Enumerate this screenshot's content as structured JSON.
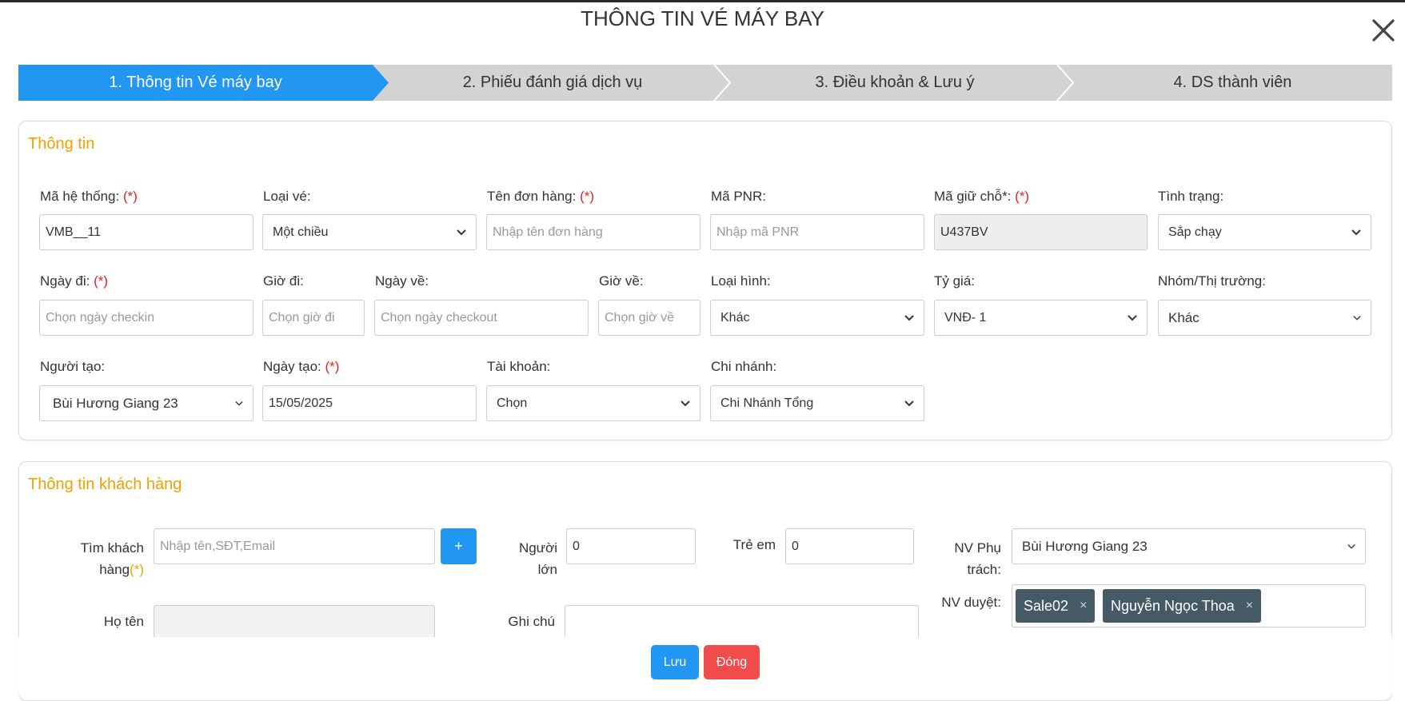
{
  "modal": {
    "title": "THÔNG TIN VÉ MÁY BAY"
  },
  "steps": [
    {
      "label": "1. Thông tin Vé máy bay"
    },
    {
      "label": "2. Phiếu đánh giá dịch vụ"
    },
    {
      "label": "3. Điều khoản & Lưu ý"
    },
    {
      "label": "4. DS thành viên"
    }
  ],
  "colors": {
    "active_step": "#2196f3",
    "inactive_step": "#d3d3d3",
    "section_title": "#f0a000",
    "required": "#e02020",
    "save": "#2196f3",
    "close": "#f24b4b",
    "tag": "#455a64"
  },
  "info": {
    "title": "Thông tin",
    "ma_he_thong": {
      "label": "Mã hệ thống:",
      "req": "(*)",
      "value": "VMB__11"
    },
    "loai_ve": {
      "label": "Loại vé:",
      "value": "Một chiều"
    },
    "ten_don_hang": {
      "label": "Tên đơn hàng:",
      "req": "(*)",
      "placeholder": "Nhập tên đơn hàng"
    },
    "ma_pnr": {
      "label": "Mã PNR:",
      "placeholder": "Nhập mã PNR"
    },
    "ma_giu_cho": {
      "label": "Mã giữ chỗ*:",
      "req": "(*)",
      "value": "U437BV"
    },
    "tinh_trang": {
      "label": "Tình trạng:",
      "value": "Sắp chạy"
    },
    "ngay_di": {
      "label": "Ngày đi:",
      "req": "(*)",
      "placeholder": "Chọn ngày checkin"
    },
    "gio_di": {
      "label": "Giờ đi:",
      "placeholder": "Chọn giờ đi"
    },
    "ngay_ve": {
      "label": "Ngày về:",
      "placeholder": "Chọn ngày checkout"
    },
    "gio_ve": {
      "label": "Giờ về:",
      "placeholder": "Chọn giờ về"
    },
    "loai_hinh": {
      "label": "Loại hình:",
      "value": "Khác"
    },
    "ty_gia": {
      "label": "Tỷ giá:",
      "value": "VNĐ- 1"
    },
    "nhom": {
      "label": "Nhóm/Thị trường:",
      "value": "Khác"
    },
    "nguoi_tao": {
      "label": "Người tạo:",
      "value": "Bùi Hương Giang 23"
    },
    "ngay_tao": {
      "label": "Ngày tạo:",
      "req": "(*)",
      "value": "15/05/2025"
    },
    "tai_khoan": {
      "label": "Tài khoản:",
      "value": "Chọn"
    },
    "chi_nhanh": {
      "label": "Chi nhánh:",
      "value": "Chi Nhánh Tổng"
    }
  },
  "customer": {
    "title": "Thông tin khách hàng",
    "tim_kh": {
      "label1": "Tìm khách",
      "label2": "hàng",
      "req": "(*)",
      "placeholder": "Nhập tên,SĐT,Email"
    },
    "add_button": "+",
    "nguoi_lon": {
      "label1": "Người",
      "label2": "lớn",
      "value": "0"
    },
    "tre_em": {
      "label": "Trẻ em",
      "value": "0"
    },
    "nv_phu_trach": {
      "label1": "NV Phụ",
      "label2": "trách:",
      "value": "Bùi Hương Giang 23"
    },
    "nv_duyet": {
      "label": "NV duyệt:",
      "tags": [
        "Sale02",
        "Nguyễn Ngọc Thoa"
      ],
      "remove": "×"
    },
    "ho_ten": {
      "label": "Họ tên",
      "value": ""
    },
    "ghi_chu": {
      "label": "Ghi chú",
      "value": ""
    }
  },
  "footer": {
    "save": "Lưu",
    "close": "Đóng"
  }
}
